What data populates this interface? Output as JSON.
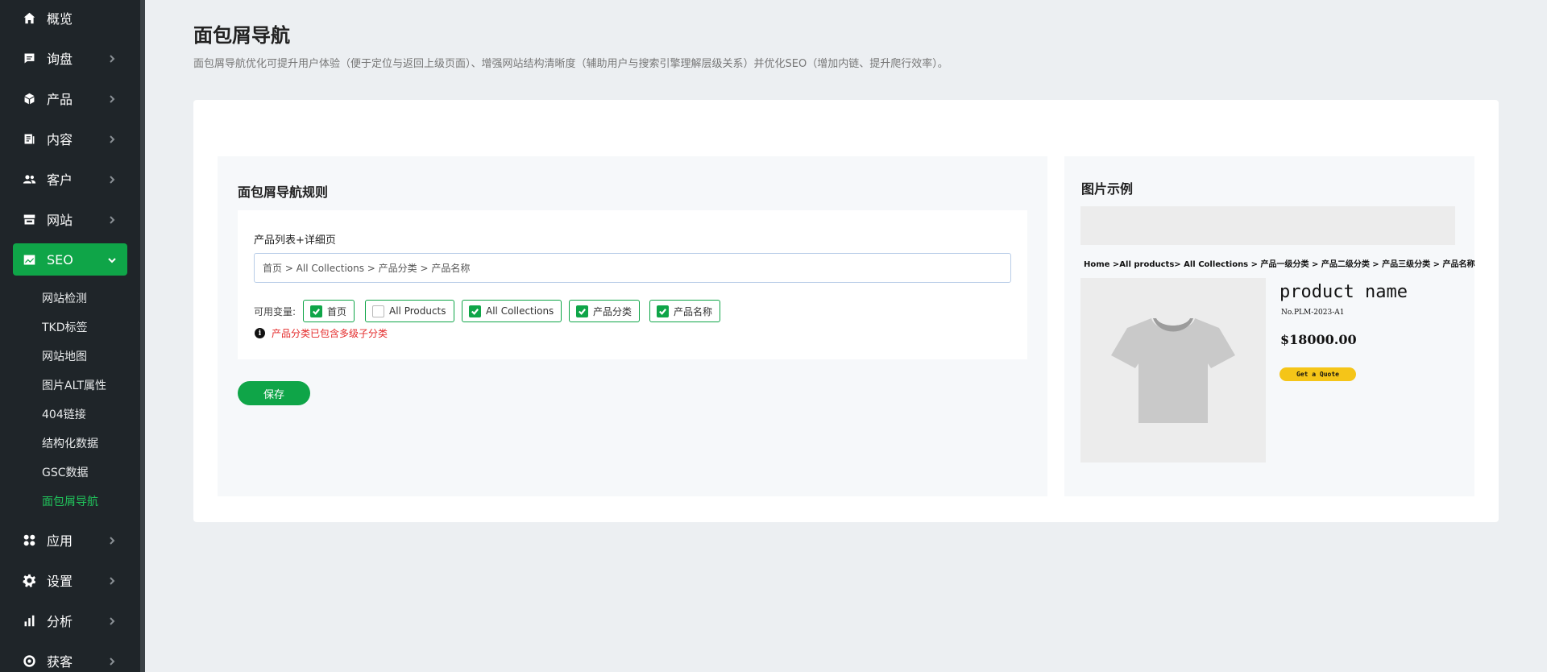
{
  "sidebar": {
    "items": [
      {
        "label": "概览",
        "icon": "home-icon"
      },
      {
        "label": "询盘",
        "icon": "inquiry-icon"
      },
      {
        "label": "产品",
        "icon": "cube-icon"
      },
      {
        "label": "内容",
        "icon": "document-icon"
      },
      {
        "label": "客户",
        "icon": "users-icon"
      },
      {
        "label": "网站",
        "icon": "store-icon"
      },
      {
        "label": "SEO",
        "icon": "seo-chart-icon"
      },
      {
        "label": "应用",
        "icon": "apps-icon"
      },
      {
        "label": "设置",
        "icon": "gear-icon"
      },
      {
        "label": "分析",
        "icon": "bar-chart-icon"
      },
      {
        "label": "获客",
        "icon": "target-icon"
      }
    ],
    "seo_sub": [
      "网站检测",
      "TKD标签",
      "网站地图",
      "图片ALT属性",
      "404链接",
      "结构化数据",
      "GSC数据",
      "面包屑导航"
    ],
    "active_color": "#0fa548"
  },
  "page": {
    "title": "面包屑导航",
    "description": "面包屑导航优化可提升用户体验（便于定位与返回上级页面）、增强网站结构清晰度（辅助用户与搜索引擎理解层级关系）并优化SEO（增加内链、提升爬行效率）。"
  },
  "rules": {
    "title": "面包屑导航规则",
    "rule_label": "产品列表+详细页",
    "rule_value": "首页 > All Collections > 产品分类 > 产品名称",
    "vars_label": "可用变量:",
    "variables": [
      {
        "label": "首页",
        "checked": true
      },
      {
        "label": "All Products",
        "checked": false
      },
      {
        "label": "All Collections",
        "checked": true
      },
      {
        "label": "产品分类",
        "checked": true
      },
      {
        "label": "产品名称",
        "checked": true
      }
    ],
    "warning": "产品分类已包含多级子分类",
    "save_label": "保存"
  },
  "example": {
    "title": "图片示例",
    "breadcrumb": "Home >All products> All Collections > 产品一级分类 > 产品二级分类 > 产品三级分类 > 产品名称",
    "product_name": "product name",
    "product_no": "No.PLM-2023-A1",
    "price": "$18000.00",
    "quote_label": "Get a Quote"
  }
}
